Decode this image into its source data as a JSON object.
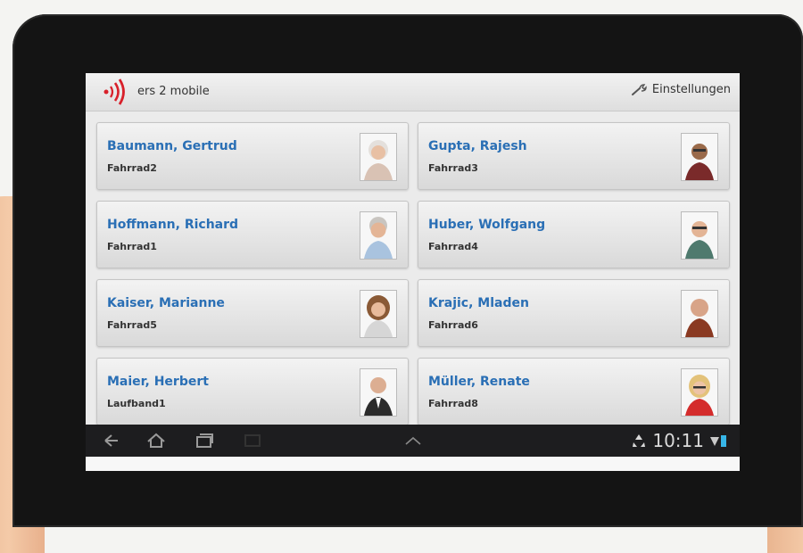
{
  "app": {
    "title": "ers 2 mobile",
    "settings_label": "Einstellungen",
    "brand_color": "#d8202a",
    "accent_color": "#2a6fb5"
  },
  "users": [
    {
      "name": "Baumann, Gertrud",
      "device": "Fahrrad2",
      "avatar_icon": "elderly-woman-photo"
    },
    {
      "name": "Gupta, Rajesh",
      "device": "Fahrrad3",
      "avatar_icon": "elderly-man-photo"
    },
    {
      "name": "Hoffmann, Richard",
      "device": "Fahrrad1",
      "avatar_icon": "elderly-man-photo"
    },
    {
      "name": "Huber, Wolfgang",
      "device": "Fahrrad4",
      "avatar_icon": "man-glasses-photo"
    },
    {
      "name": "Kaiser, Marianne",
      "device": "Fahrrad5",
      "avatar_icon": "woman-photo"
    },
    {
      "name": "Krajic, Mladen",
      "device": "Fahrrad6",
      "avatar_icon": "elderly-man-photo"
    },
    {
      "name": "Maier, Herbert",
      "device": "Laufband1",
      "avatar_icon": "man-suit-photo"
    },
    {
      "name": "Müller, Renate",
      "device": "Fahrrad8",
      "avatar_icon": "woman-glasses-photo"
    }
  ],
  "statusbar": {
    "time": "10:11",
    "icons": [
      "back-icon",
      "home-icon",
      "recent-apps-icon",
      "screenshot-icon",
      "up-chevron-icon",
      "recycle-icon",
      "wifi-icon",
      "battery-icon"
    ]
  }
}
